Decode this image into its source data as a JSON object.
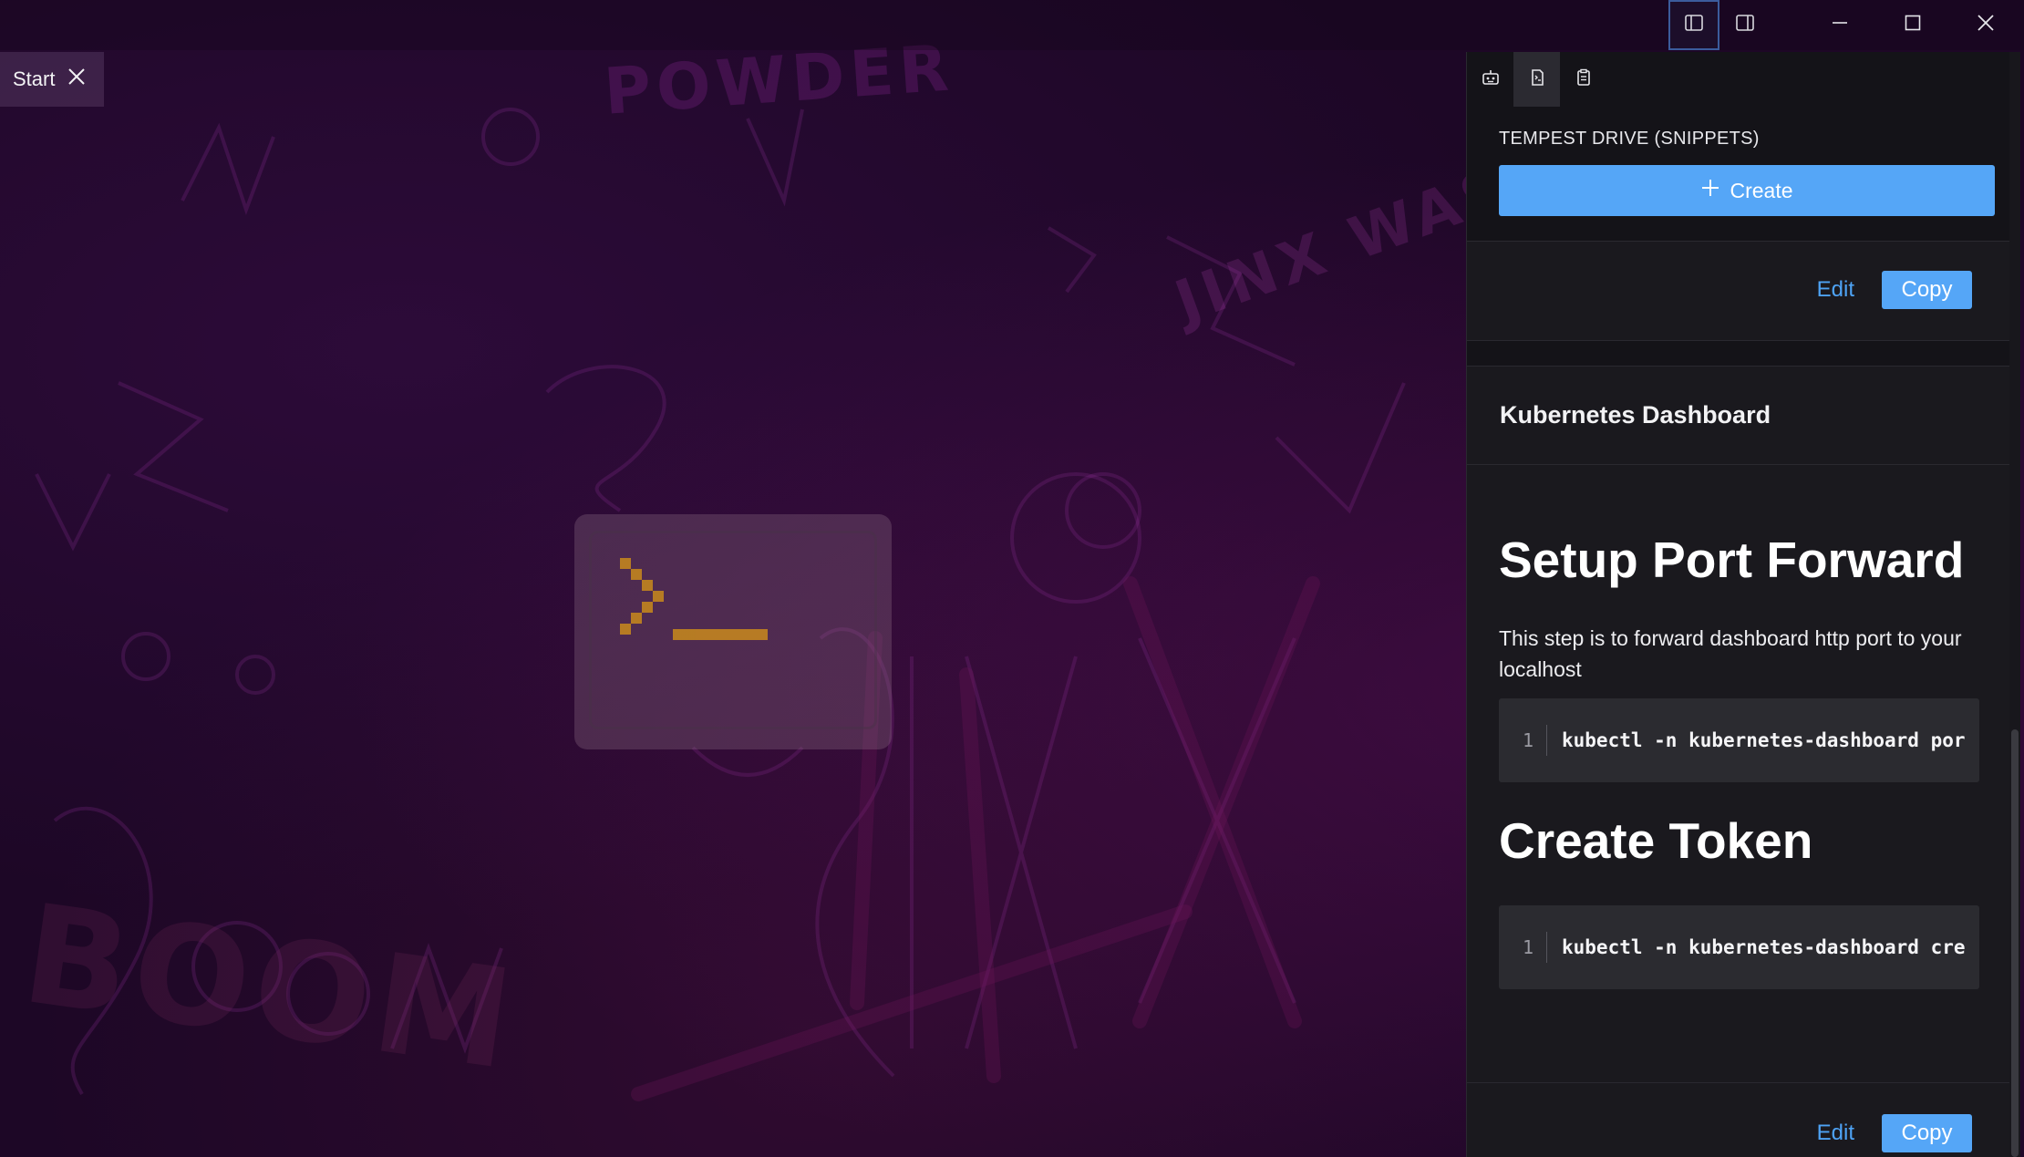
{
  "window": {
    "controls": {
      "toggle_left_panel_icon": "sidebar-left-icon",
      "toggle_right_panel_icon": "sidebar-right-icon",
      "minimize_icon": "minimize-icon",
      "maximize_icon": "maximize-icon",
      "close_icon": "close-icon"
    }
  },
  "tabs": [
    {
      "label": "Start",
      "close_icon": "close-icon"
    }
  ],
  "right_panel": {
    "toolbar_icons": [
      "robot-icon",
      "snippet-icon",
      "clipboard-icon"
    ],
    "section_title": "TEMPEST DRIVE (SNIPPETS)",
    "create_label": "Create",
    "first_card": {
      "edit_label": "Edit",
      "copy_label": "Copy"
    },
    "snippet": {
      "title": "Kubernetes Dashboard",
      "heading1": "Setup Port Forward",
      "paragraph": "This step is to forward dashboard http port to your localhost",
      "code1": {
        "line": "1",
        "text": "kubectl -n kubernetes-dashboard por"
      },
      "heading2": "Create Token",
      "code2": {
        "line": "1",
        "text": "kubectl -n kubernetes-dashboard cre"
      },
      "edit_label": "Edit",
      "copy_label": "Copy"
    }
  },
  "colors": {
    "background": "#1d0726",
    "panel": "#141318",
    "accent": "#55a6f7",
    "link": "#4ea3f5",
    "logo_prompt": "#c98a1c"
  }
}
